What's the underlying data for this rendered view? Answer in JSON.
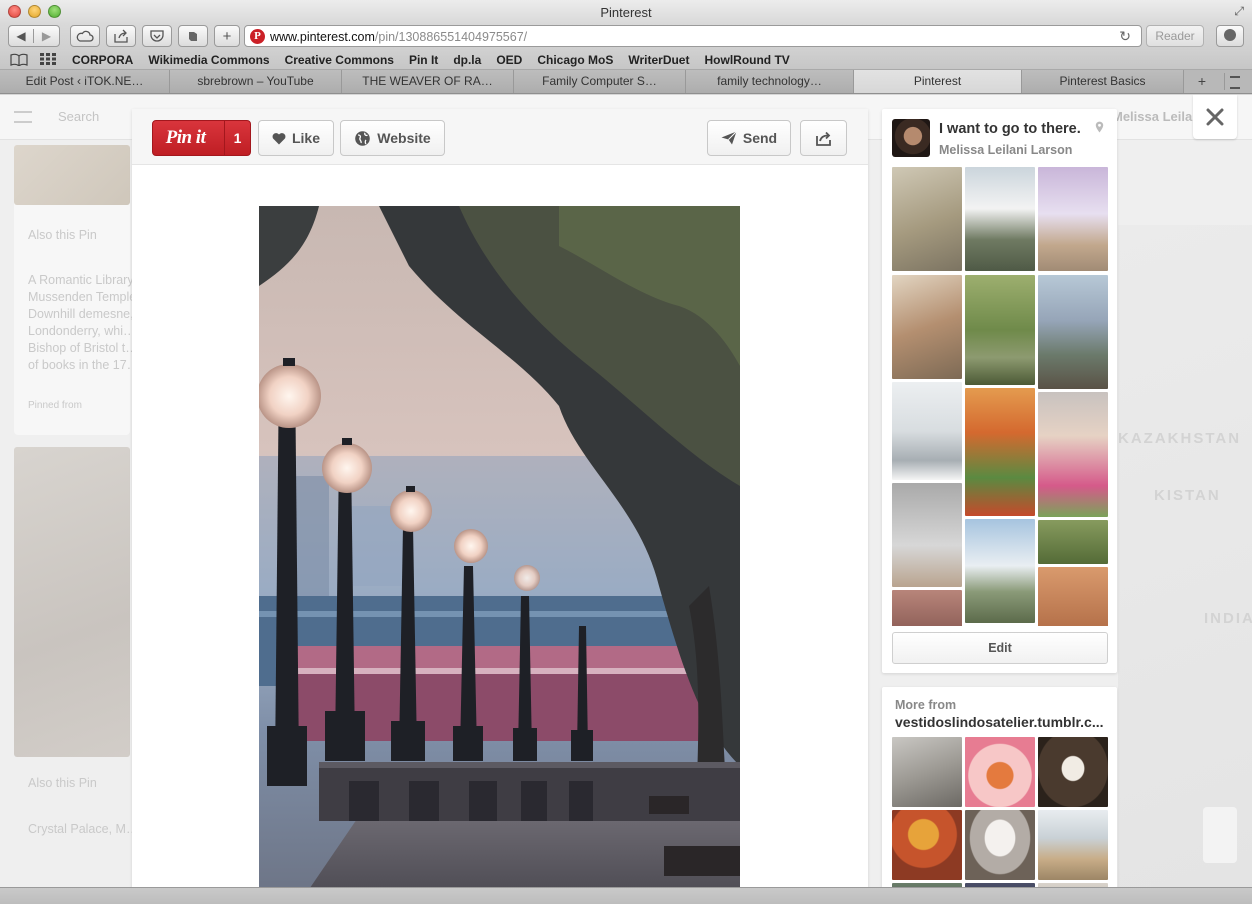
{
  "window": {
    "title": "Pinterest"
  },
  "toolbar": {
    "url_host": "www.pinterest.com",
    "url_path": "/pin/130886551404975567/",
    "reader_label": "Reader"
  },
  "bookmarks": [
    "CORPORA",
    "Wikimedia Commons",
    "Creative Commons",
    "Pin It",
    "dp.la",
    "OED",
    "Chicago MoS",
    "WriterDuet",
    "HowlRound TV"
  ],
  "tabs": [
    {
      "label": "Edit Post ‹ iTOK.NE…",
      "active": false
    },
    {
      "label": "sbrebrown – YouTube",
      "active": false
    },
    {
      "label": "THE WEAVER OF RA…",
      "active": false
    },
    {
      "label": "Family Computer S…",
      "active": false
    },
    {
      "label": "family technology…",
      "active": false
    },
    {
      "label": "Pinterest",
      "active": true
    },
    {
      "label": "Pinterest Basics",
      "active": false
    }
  ],
  "pin": {
    "pinit_label": "Pin it",
    "pinit_count": "1",
    "like_label": "Like",
    "website_label": "Website",
    "send_label": "Send",
    "image_subject": "riverside-walk-with-lamp-posts"
  },
  "board": {
    "title": "I want to go to there.",
    "owner": "Melissa Leilani Larson",
    "edit_label": "Edit"
  },
  "more_from": {
    "label": "More from",
    "source": "vestidoslindosatelier.tumblr.c..."
  },
  "background": {
    "search_placeholder": "Search",
    "user_name": "Melissa Leilani",
    "card1_heading": "Also this Pin",
    "card1_lines": [
      "A Romantic Library",
      "Mussenden Temple,",
      "Downhill demesne,",
      "Londonderry, whi…",
      "Bishop of Bristol t…",
      "of books in the 17…"
    ],
    "card1_source": "Pinned from",
    "card2_heading": "Also this Pin",
    "card2_line": "Crystal Palace, M…",
    "map_labels": [
      "KAZAKHSTAN",
      "KISTAN",
      "INDIA"
    ]
  },
  "colors": {
    "pinterest_red": "#cb2027",
    "page_bg": "#efefef",
    "card_bg": "#ffffff"
  }
}
